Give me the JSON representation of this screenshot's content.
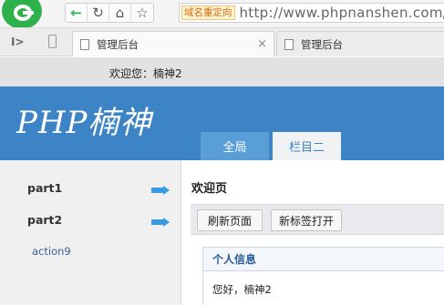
{
  "browser": {
    "nav": {
      "back": "←",
      "reload": "↻",
      "home": "⌂",
      "bookmark": "☆"
    },
    "redirect_badge": "域名重定向",
    "url": "http://www.phpnanshen.com/",
    "tabs": [
      {
        "label": "管理后台",
        "close": "×"
      },
      {
        "label": "管理后台"
      }
    ],
    "sidebar_toggle": "I>",
    "icons": [
      "browser-logo-icon",
      "back-arrow-icon",
      "reload-icon",
      "home-icon",
      "star-icon",
      "phone-icon",
      "document-icon",
      "close-icon"
    ]
  },
  "page": {
    "welcome": "欢迎您：楠神2",
    "brand": "PHP楠神",
    "nav_tabs": [
      "全局",
      "栏目二"
    ],
    "active_nav_tab": 1,
    "sidebar": {
      "items": [
        {
          "label": "part1"
        },
        {
          "label": "part2"
        }
      ],
      "sub_items": [
        {
          "label": "action9"
        }
      ]
    },
    "main": {
      "title": "欢迎页",
      "buttons": {
        "refresh": "刷新页面",
        "new_tab": "新标签打开"
      },
      "panel": {
        "title": "个人信息",
        "body": "您好，楠神2"
      }
    },
    "colors": {
      "header": "#3d84c6",
      "nav_tab_inactive": "#5a9ed8",
      "nav_tab_active_bg": "#f0f2f4",
      "arrow": "#3a9be0",
      "redirect_badge": "#fff4d2"
    }
  }
}
